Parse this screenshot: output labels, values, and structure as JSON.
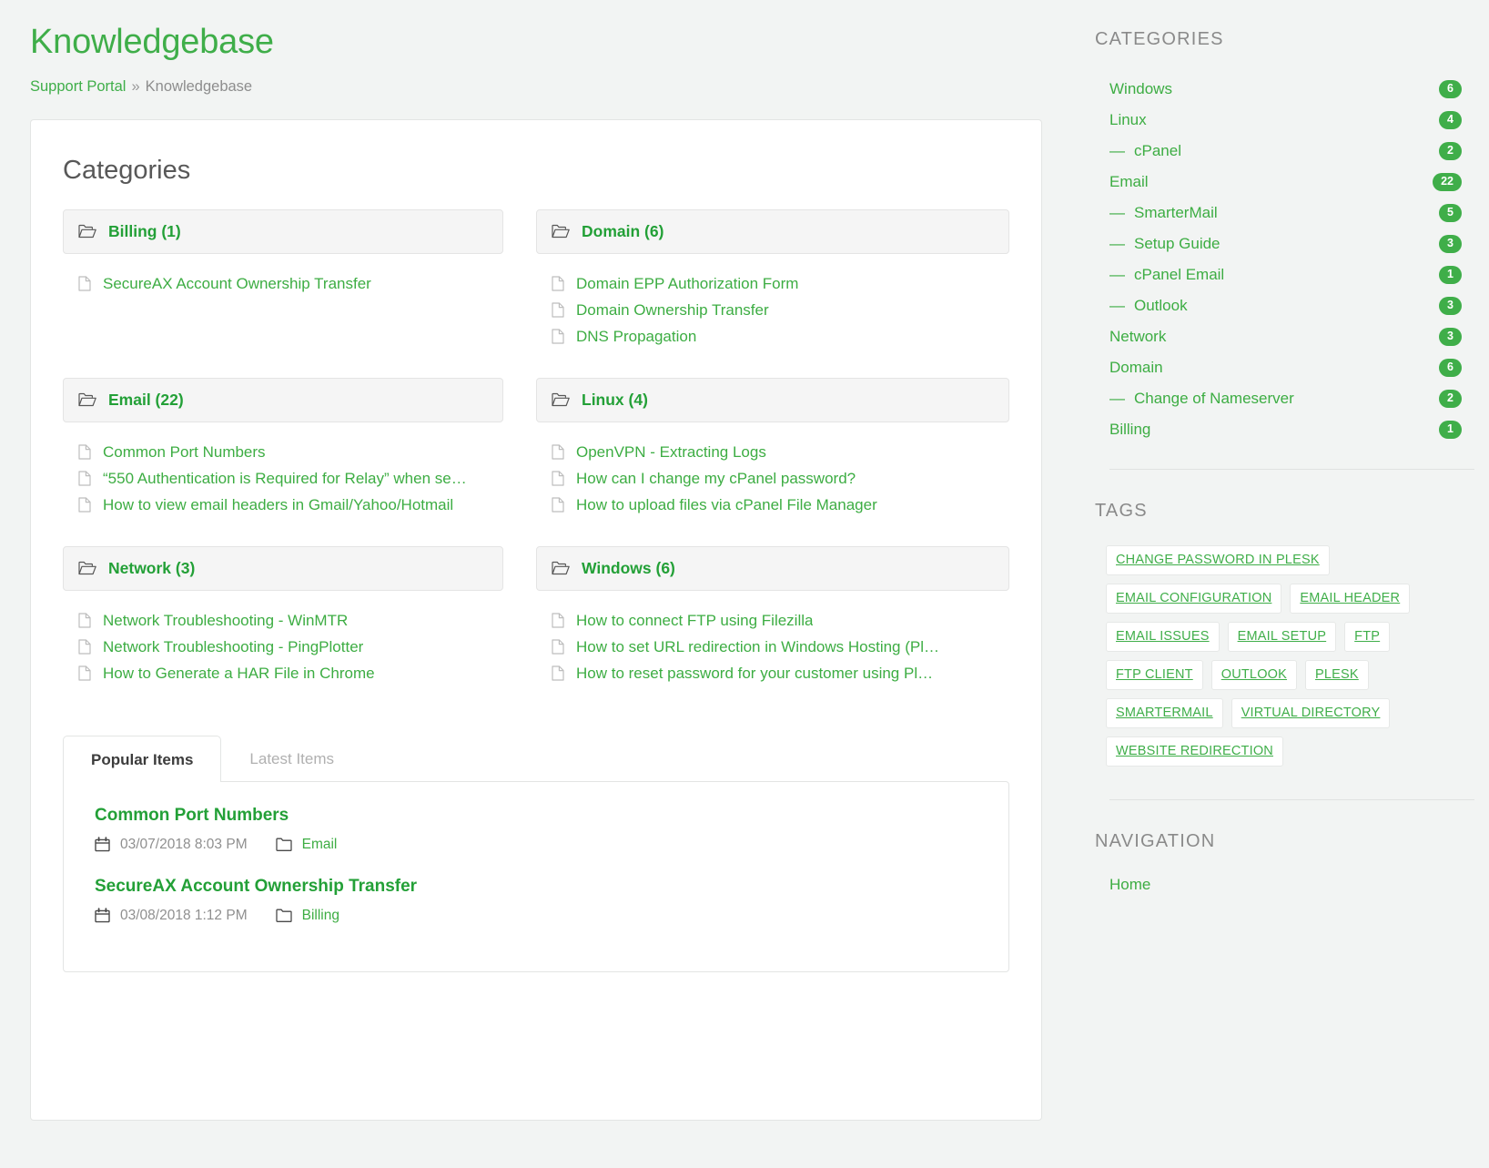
{
  "header": {
    "title": "Knowledgebase",
    "breadcrumb": {
      "root": "Support Portal",
      "separator": "»",
      "current": "Knowledgebase"
    }
  },
  "main": {
    "panel_title": "Categories",
    "categories": [
      {
        "label": "Billing (1)",
        "icon": "folder-open-icon",
        "items": [
          "SecureAX Account Ownership Transfer"
        ]
      },
      {
        "label": "Domain (6)",
        "icon": "folder-open-icon",
        "items": [
          "Domain EPP Authorization Form",
          "Domain Ownership Transfer",
          "DNS Propagation"
        ]
      },
      {
        "label": "Email (22)",
        "icon": "folder-open-icon",
        "items": [
          "Common Port Numbers",
          "“550 Authentication is Required for Relay” when se…",
          "How to view email headers in Gmail/Yahoo/Hotmail"
        ]
      },
      {
        "label": "Linux (4)",
        "icon": "folder-open-icon",
        "items": [
          "OpenVPN - Extracting Logs",
          "How can I change my cPanel password?",
          "How to upload files via cPanel File Manager"
        ]
      },
      {
        "label": "Network (3)",
        "icon": "folder-open-icon",
        "items": [
          "Network Troubleshooting - WinMTR",
          "Network Troubleshooting - PingPlotter",
          "How to Generate a HAR File in Chrome"
        ]
      },
      {
        "label": "Windows (6)",
        "icon": "folder-open-icon",
        "items": [
          "How to connect FTP using Filezilla",
          "How to set URL redirection in Windows Hosting (Pl…",
          "How to reset password for your customer using Pl…"
        ]
      }
    ],
    "tabs": [
      {
        "label": "Popular Items",
        "active": true
      },
      {
        "label": "Latest Items",
        "active": false
      }
    ],
    "popular_items": [
      {
        "title": "Common Port Numbers",
        "date": "03/07/2018 8:03 PM",
        "category": "Email"
      },
      {
        "title": "SecureAX Account Ownership Transfer",
        "date": "03/08/2018 1:12 PM",
        "category": "Billing"
      }
    ]
  },
  "sidebar": {
    "categories_heading": "CATEGORIES",
    "categories": [
      {
        "label": "Windows",
        "count": "6",
        "sub": false
      },
      {
        "label": "Linux",
        "count": "4",
        "sub": false
      },
      {
        "label": "cPanel",
        "count": "2",
        "sub": true
      },
      {
        "label": "Email",
        "count": "22",
        "sub": false
      },
      {
        "label": "SmarterMail",
        "count": "5",
        "sub": true
      },
      {
        "label": "Setup Guide",
        "count": "3",
        "sub": true
      },
      {
        "label": "cPanel Email",
        "count": "1",
        "sub": true
      },
      {
        "label": "Outlook",
        "count": "3",
        "sub": true
      },
      {
        "label": "Network",
        "count": "3",
        "sub": false
      },
      {
        "label": "Domain",
        "count": "6",
        "sub": false
      },
      {
        "label": "Change of Nameserver",
        "count": "2",
        "sub": true
      },
      {
        "label": "Billing",
        "count": "1",
        "sub": false
      }
    ],
    "tags_heading": "TAGS",
    "tags": [
      "CHANGE PASSWORD IN PLESK",
      "EMAIL CONFIGURATION",
      "EMAIL HEADER",
      "EMAIL ISSUES",
      "EMAIL SETUP",
      "FTP",
      "FTP CLIENT",
      "OUTLOOK",
      "PLESK",
      "SMARTERMAIL",
      "VIRTUAL DIRECTORY",
      "WEBSITE REDIRECTION"
    ],
    "navigation_heading": "NAVIGATION",
    "navigation": [
      "Home"
    ]
  },
  "colors": {
    "green": "#3fae49",
    "green_dark": "#23a037",
    "text_gray": "#8a8a8a",
    "bg": "#f2f4f3"
  }
}
